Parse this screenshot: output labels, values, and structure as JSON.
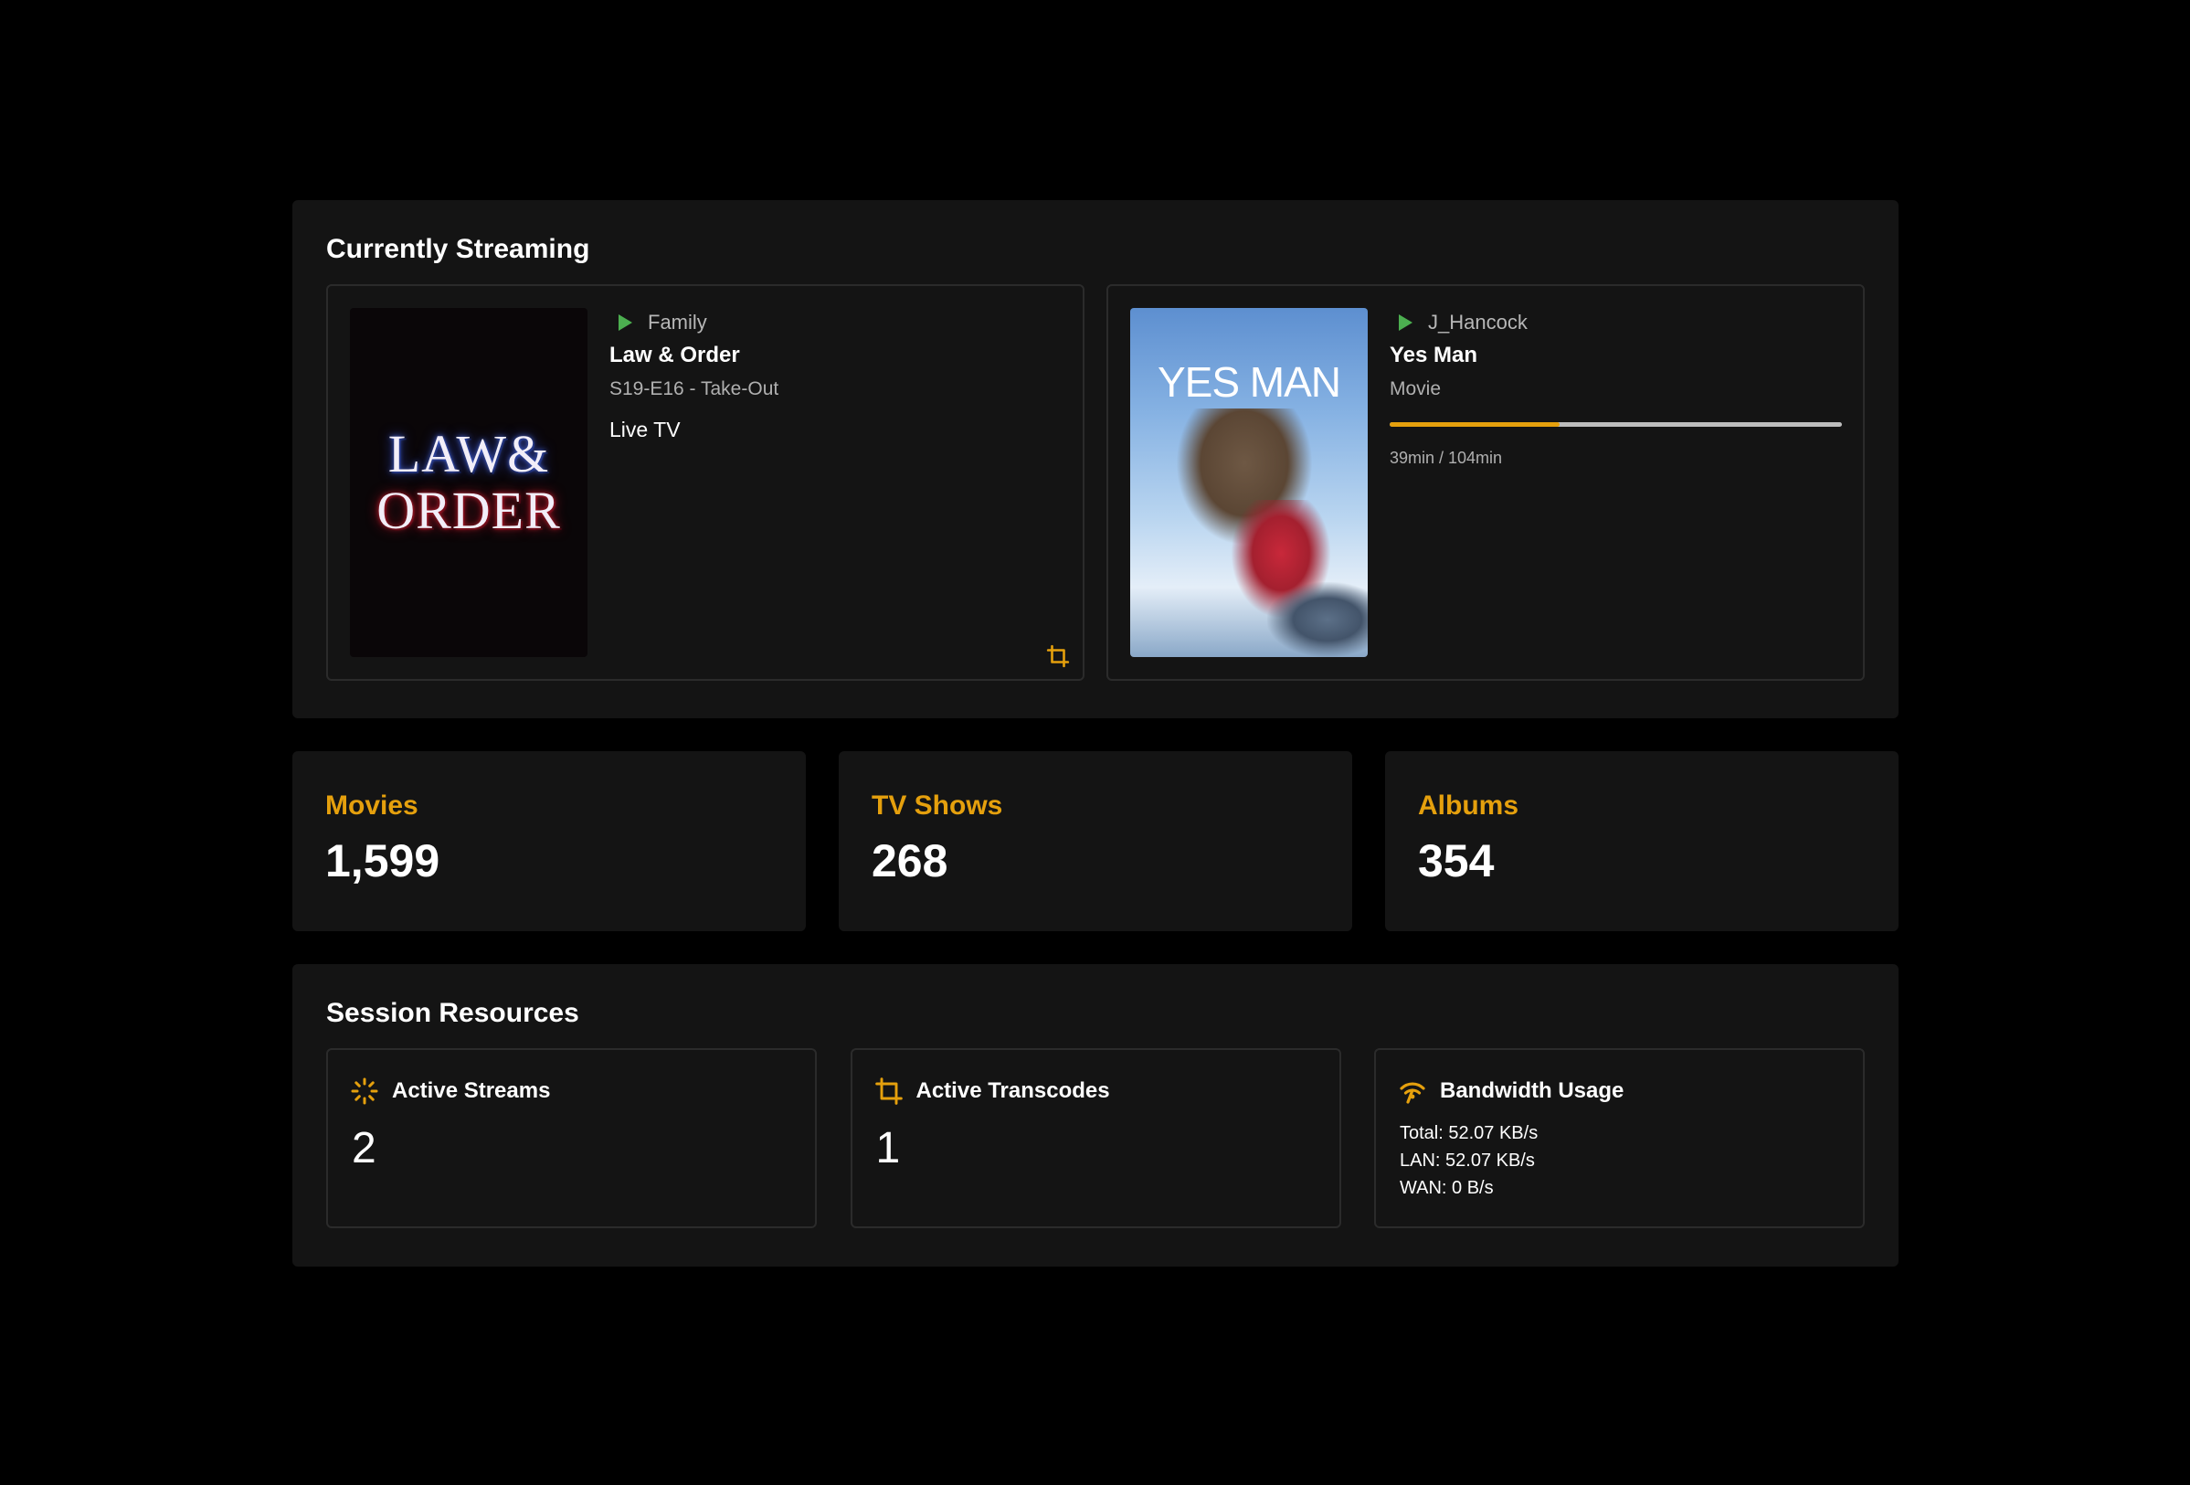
{
  "streaming": {
    "title": "Currently Streaming",
    "sessions": [
      {
        "user": "Family",
        "title": "Law & Order",
        "subtitle": "S19-E16 - Take-Out",
        "extra": "Live TV",
        "poster_line1": "LAW&",
        "poster_line2": "ORDER",
        "transcoding": true
      },
      {
        "user": "J_Hancock",
        "title": "Yes Man",
        "subtitle": "Movie",
        "poster_text": "YES MAN",
        "progress_fraction": 0.375,
        "progress_text": "39min / 104min",
        "transcoding": false
      }
    ]
  },
  "stats": [
    {
      "label": "Movies",
      "value": "1,599"
    },
    {
      "label": "TV Shows",
      "value": "268"
    },
    {
      "label": "Albums",
      "value": "354"
    }
  ],
  "resources": {
    "title": "Session Resources",
    "active_streams": {
      "label": "Active Streams",
      "value": "2",
      "icon": "spinner-icon"
    },
    "active_transcodes": {
      "label": "Active Transcodes",
      "value": "1",
      "icon": "crop-icon"
    },
    "bandwidth": {
      "label": "Bandwidth Usage",
      "icon": "wifi-signal-icon",
      "total": "Total: 52.07 KB/s",
      "lan": "LAN: 52.07 KB/s",
      "wan": "WAN: 0 B/s"
    }
  },
  "colors": {
    "accent": "#e5a00d",
    "play": "#4caf50",
    "panel": "#141414",
    "background": "#000000"
  }
}
